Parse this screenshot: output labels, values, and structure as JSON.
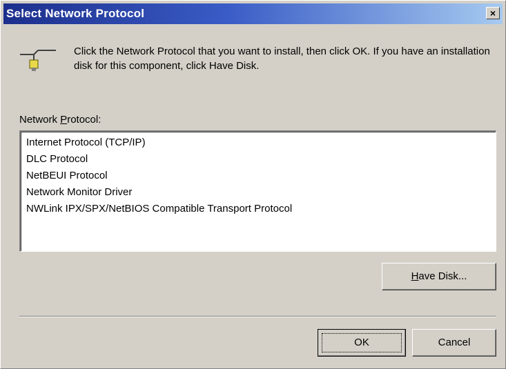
{
  "window": {
    "title": "Select Network Protocol",
    "close_glyph": "×"
  },
  "instructions": "Click the Network Protocol that you want to install, then click OK. If you have an installation disk for this component, click Have Disk.",
  "icon": "network-card-icon",
  "protocol_list": {
    "label_prefix": "Network ",
    "label_accel": "P",
    "label_suffix": "rotocol:",
    "items": [
      {
        "label": "Internet Protocol (TCP/IP)"
      },
      {
        "label": "DLC Protocol"
      },
      {
        "label": "NetBEUI Protocol"
      },
      {
        "label": "Network Monitor Driver"
      },
      {
        "label": "NWLink IPX/SPX/NetBIOS Compatible Transport Protocol"
      }
    ]
  },
  "buttons": {
    "have_disk_accel": "H",
    "have_disk_rest": "ave Disk...",
    "ok": "OK",
    "cancel": "Cancel"
  }
}
